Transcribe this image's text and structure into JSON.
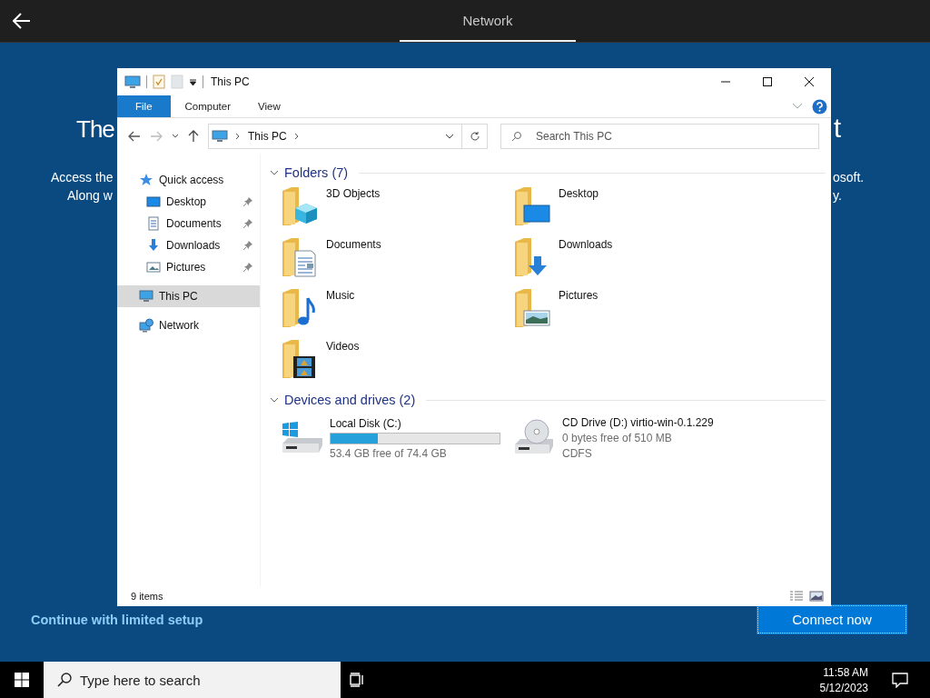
{
  "header": {
    "title": "Network"
  },
  "background": {
    "heading": [
      "The",
      "t"
    ],
    "lines": [
      [
        "Access the",
        "osoft."
      ],
      [
        "Along w",
        "y."
      ]
    ]
  },
  "explorer": {
    "title": "This PC",
    "ribbon_tabs": [
      {
        "label": "File",
        "selected": true
      },
      {
        "label": "Computer",
        "selected": false
      },
      {
        "label": "View",
        "selected": false
      }
    ],
    "address": {
      "path": "This PC"
    },
    "search": {
      "placeholder": "Search This PC"
    },
    "nav": [
      {
        "label": "Quick access",
        "kind": "star",
        "selected": false,
        "children": [
          {
            "label": "Desktop",
            "kind": "desktop",
            "pinned": true,
            "selected": false
          },
          {
            "label": "Documents",
            "kind": "documents",
            "pinned": true,
            "selected": false
          },
          {
            "label": "Downloads",
            "kind": "downloads",
            "pinned": true,
            "selected": false
          },
          {
            "label": "Pictures",
            "kind": "pictures",
            "pinned": true,
            "selected": false
          }
        ]
      },
      {
        "label": "This PC",
        "kind": "pc",
        "selected": true
      },
      {
        "label": "Network",
        "kind": "network",
        "selected": false
      }
    ],
    "folders": {
      "title": "Folders (7)",
      "items": [
        {
          "kind": "cube",
          "name": "3D Objects"
        },
        {
          "kind": "desktop",
          "name": "Desktop"
        },
        {
          "kind": "documents",
          "name": "Documents"
        },
        {
          "kind": "downloads",
          "name": "Downloads"
        },
        {
          "kind": "music",
          "name": "Music"
        },
        {
          "kind": "pictures",
          "name": "Pictures"
        },
        {
          "kind": "videos",
          "name": "Videos"
        }
      ]
    },
    "drives": {
      "title": "Devices and drives (2)",
      "items": [
        {
          "kind": "disk",
          "name": "Local Disk (C:)",
          "level": 0.28,
          "free": "53.4 GB free of 74.4 GB"
        },
        {
          "kind": "cd",
          "name": "CD Drive (D:) virtio-win-0.1.229",
          "free": "0 bytes free of 510 MB",
          "file_system": "CDFS"
        }
      ]
    },
    "status": {
      "count": "9 items"
    }
  },
  "continue_link": "Continue with limited setup",
  "connect_button": "Connect now",
  "taskbar": {
    "search_placeholder": "Type here to search",
    "time": "11:58 AM",
    "date": "5/12/2023"
  }
}
